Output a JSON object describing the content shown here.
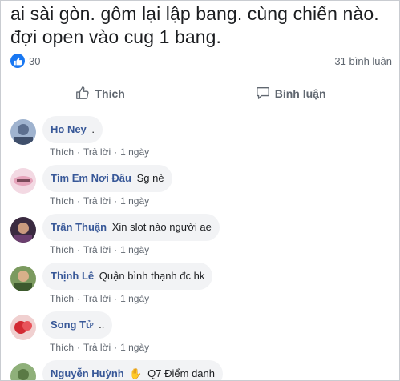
{
  "post": {
    "text_line1": "ai sài gòn. gôm lại lập bang. cùng chiến nào.",
    "text_line2": "đợi open vào cug 1 bang.",
    "reaction_count": "30",
    "comment_count": "31 bình luận"
  },
  "actions": {
    "like_label": "Thích",
    "comment_label": "Bình luận"
  },
  "comment_meta": {
    "like": "Thích",
    "reply": "Trả lời",
    "sep": "·",
    "time": "1 ngày"
  },
  "comments": [
    {
      "author": "Ho Ney",
      "text": ".",
      "avatar_color": "#7a8fb0"
    },
    {
      "author": "Tìm Em Nơi Đâu",
      "text": "Sg nè",
      "avatar_color": "#e8b7c8"
    },
    {
      "author": "Trần Thuận",
      "text": "Xin slot nào người ae",
      "avatar_color": "#5a3f5e"
    },
    {
      "author": "Thịnh Lê",
      "text": "Quận bình thạnh đc hk",
      "avatar_color": "#5f7a4a"
    },
    {
      "author": "Song Tử",
      "text": "..",
      "avatar_color": "#c9363a"
    },
    {
      "author": "Nguyễn Huỳnh",
      "text": "Q7 Điểm danh",
      "emoji": "✋",
      "avatar_color": "#6b8d5a"
    }
  ],
  "colors": {
    "link_blue": "#385898",
    "like_blue": "#1877f2",
    "meta_gray": "#606770",
    "bubble_bg": "#f2f3f5"
  }
}
